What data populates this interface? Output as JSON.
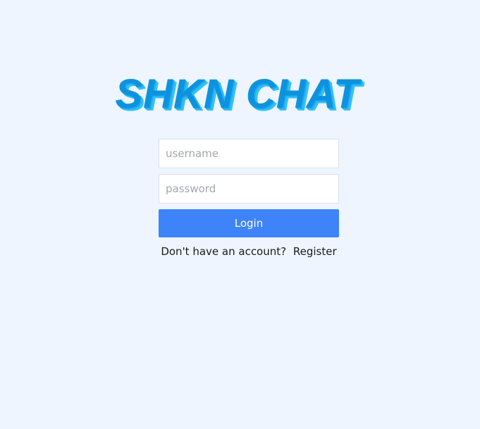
{
  "logo": {
    "text": "SHKN CHAT"
  },
  "form": {
    "username_placeholder": "username",
    "password_placeholder": "password",
    "login_label": "Login"
  },
  "register": {
    "prompt": "Don't have an account?",
    "link_label": "Register"
  },
  "colors": {
    "background": "#eef5ff",
    "logo_primary": "#0d93de",
    "logo_shadow": "#3ac2f8",
    "button_primary": "#3f83f8"
  }
}
